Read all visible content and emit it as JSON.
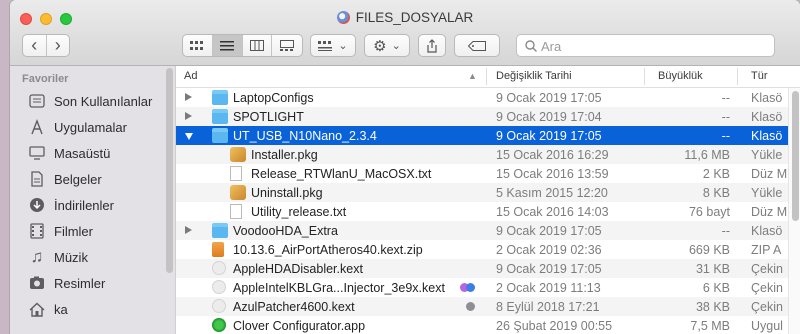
{
  "window": {
    "title": "FILES_DOSYALAR"
  },
  "toolbar": {
    "back_glyph": "‹",
    "forward_glyph": "›",
    "dropdown_glyph": "⌄",
    "search_placeholder": "Ara"
  },
  "sidebar": {
    "heading": "Favoriler",
    "items": [
      {
        "label": "Son Kullanılanlar",
        "icon": "clock-icon"
      },
      {
        "label": "Uygulamalar",
        "icon": "applications-icon"
      },
      {
        "label": "Masaüstü",
        "icon": "desktop-icon"
      },
      {
        "label": "Belgeler",
        "icon": "documents-icon"
      },
      {
        "label": "İndirilenler",
        "icon": "downloads-icon"
      },
      {
        "label": "Filmler",
        "icon": "movies-icon"
      },
      {
        "label": "Müzik",
        "icon": "music-icon"
      },
      {
        "label": "Resimler",
        "icon": "pictures-icon"
      },
      {
        "label": "ka",
        "icon": "home-icon"
      }
    ]
  },
  "columns": {
    "name": "Ad",
    "date": "Değişiklik Tarihi",
    "size": "Büyüklük",
    "kind": "Tür"
  },
  "files": [
    {
      "name": "LaptopConfigs",
      "date": "9 Ocak 2019 17:05",
      "size": "--",
      "kind": "Klasö",
      "type": "folder",
      "expand": "collapsed",
      "level": 0
    },
    {
      "name": "SPOTLIGHT",
      "date": "9 Ocak 2019 17:04",
      "size": "--",
      "kind": "Klasö",
      "type": "folder",
      "expand": "collapsed",
      "level": 0
    },
    {
      "name": "UT_USB_N10Nano_2.3.4",
      "date": "9 Ocak 2019 17:05",
      "size": "--",
      "kind": "Klasö",
      "type": "folder",
      "expand": "expanded",
      "level": 0,
      "selected": true
    },
    {
      "name": "Installer.pkg",
      "date": "15 Ocak 2016 16:29",
      "size": "11,6 MB",
      "kind": "Yükle",
      "type": "pkg",
      "level": 1
    },
    {
      "name": "Release_RTWlanU_MacOSX.txt",
      "date": "15 Ocak 2016 13:59",
      "size": "2 KB",
      "kind": "Düz M",
      "type": "doc",
      "level": 1
    },
    {
      "name": "Uninstall.pkg",
      "date": "5 Kasım 2015 12:20",
      "size": "8 KB",
      "kind": "Yükle",
      "type": "pkg",
      "level": 1
    },
    {
      "name": "Utility_release.txt",
      "date": "15 Ocak 2016 14:03",
      "size": "76 bayt",
      "kind": "Düz M",
      "type": "doc",
      "level": 1
    },
    {
      "name": "VoodooHDA_Extra",
      "date": "9 Ocak 2019 17:05",
      "size": "--",
      "kind": "Klasö",
      "type": "folder",
      "expand": "collapsed",
      "level": 0
    },
    {
      "name": "10.13.6_AirPortAtheros40.kext.zip",
      "date": "2 Ocak 2019 02:36",
      "size": "669 KB",
      "kind": "ZIP A",
      "type": "zip",
      "level": 0
    },
    {
      "name": "AppleHDADisabler.kext",
      "date": "9 Ocak 2019 17:05",
      "size": "31 KB",
      "kind": "Çekin",
      "type": "kext",
      "level": 0
    },
    {
      "name": "AppleIntelKBLGra...Injector_3e9x.kext",
      "date": "2 Ocak 2019 11:13",
      "size": "6 KB",
      "kind": "Çekin",
      "type": "kext",
      "level": 0,
      "tags": [
        "#b565e0",
        "#3d7ee6"
      ]
    },
    {
      "name": "AzulPatcher4600.kext",
      "date": "8 Eylül 2018 17:21",
      "size": "38 KB",
      "kind": "Çekin",
      "type": "kext",
      "level": 0,
      "tags": [
        "#8e8e93"
      ]
    },
    {
      "name": "Clover Configurator.app",
      "date": "26 Şubat 2019 00:55",
      "size": "7,5 MB",
      "kind": "Uygul",
      "type": "app",
      "level": 0
    }
  ],
  "colors": {
    "selection": "#0a62d8",
    "folder": "#5bb7f0"
  }
}
